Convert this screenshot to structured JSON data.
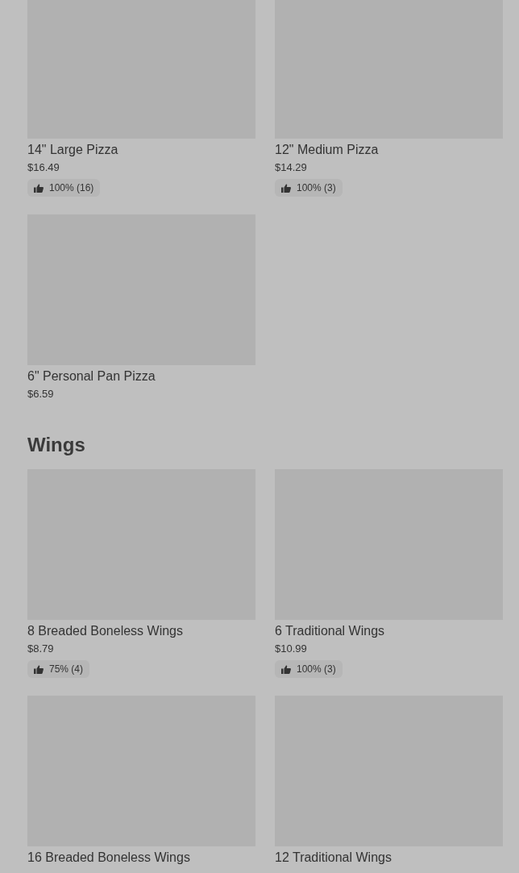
{
  "sections": [
    {
      "items": [
        {
          "name": "14\" Large Pizza",
          "price": "$16.49",
          "rating": "100% (16)"
        },
        {
          "name": "12\" Medium Pizza",
          "price": "$14.29",
          "rating": "100% (3)"
        },
        {
          "name": "6\" Personal Pan Pizza",
          "price": "$6.59"
        }
      ]
    },
    {
      "title": "Wings",
      "items": [
        {
          "name": "8 Breaded Boneless Wings",
          "price": "$8.79",
          "rating": "75% (4)"
        },
        {
          "name": "6 Traditional Wings",
          "price": "$10.99",
          "rating": "100% (3)"
        },
        {
          "name": "16 Breaded Boneless Wings"
        },
        {
          "name": "12 Traditional Wings"
        }
      ]
    }
  ]
}
